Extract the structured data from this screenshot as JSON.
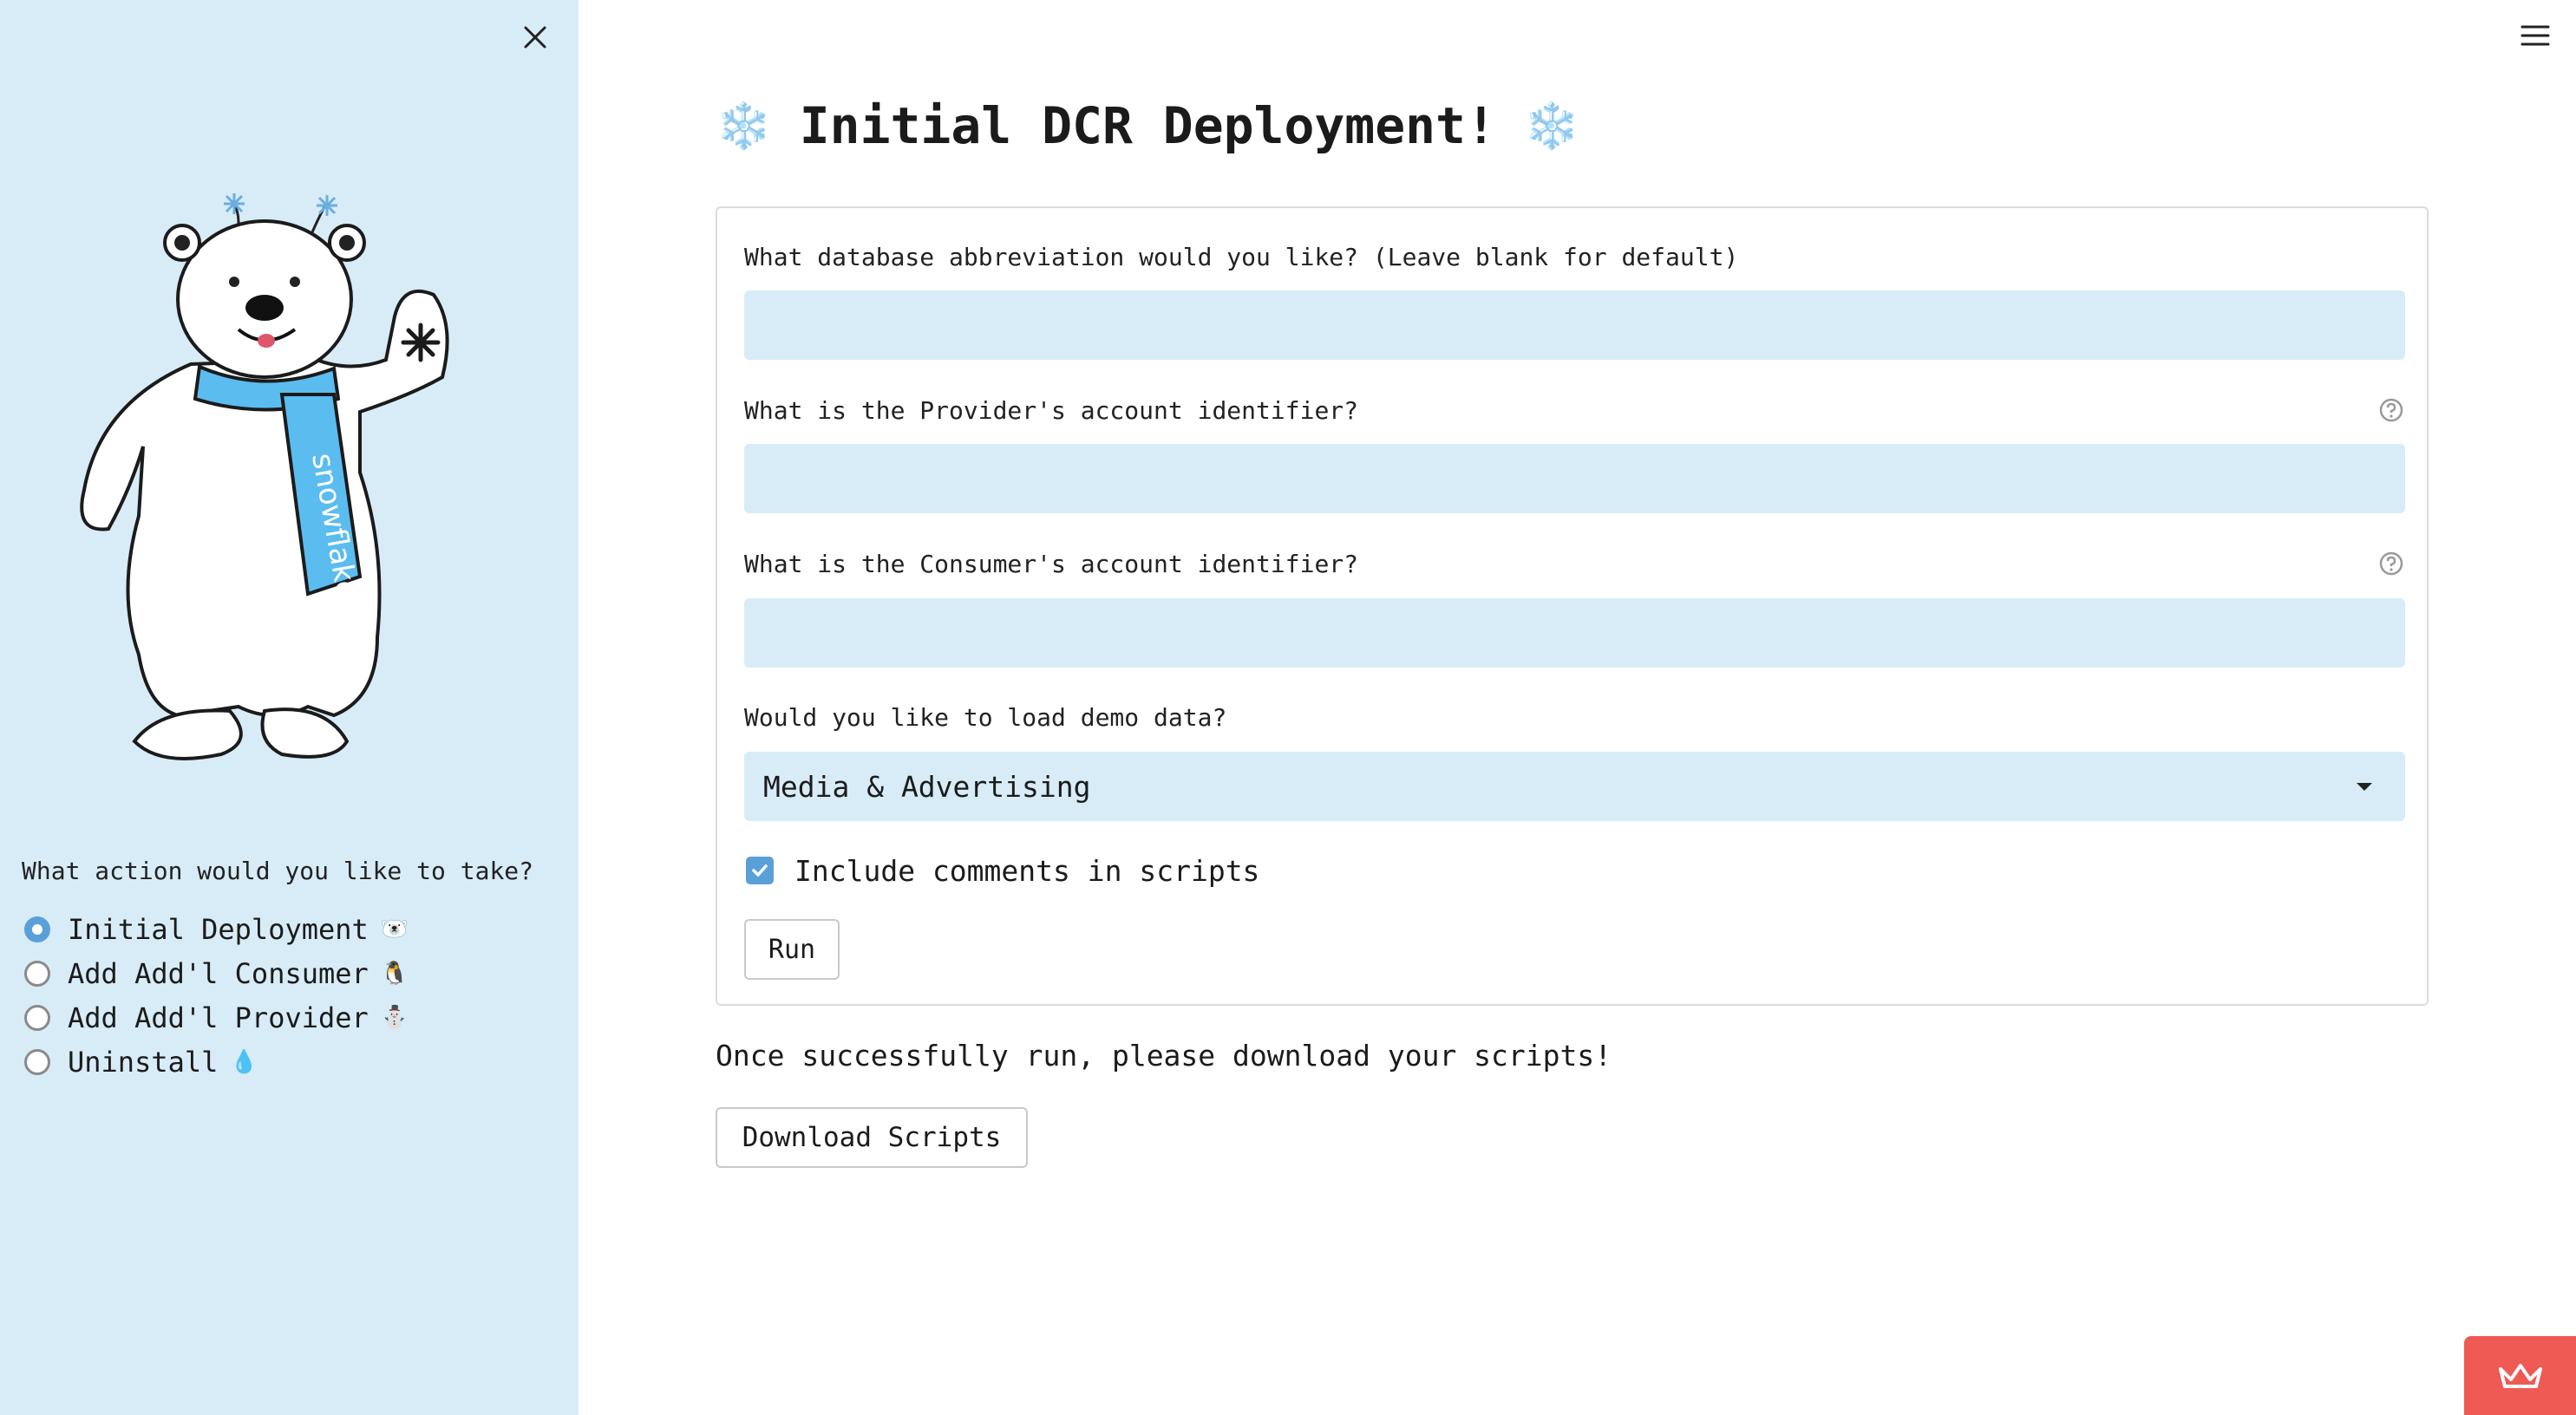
{
  "sidebar": {
    "close_icon": "close-icon",
    "mascot": "polar-bear-mascot",
    "mascot_scarf_text": "snowflake",
    "question": "What action would you like to take?",
    "options": [
      {
        "label": "Initial Deployment",
        "emoji": "🐻‍❄️",
        "selected": true
      },
      {
        "label": "Add Add'l Consumer",
        "emoji": "🐧",
        "selected": false
      },
      {
        "label": "Add Add'l Provider",
        "emoji": "⛄",
        "selected": false
      },
      {
        "label": "Uninstall",
        "emoji": "💧",
        "selected": false
      }
    ]
  },
  "header": {
    "menu_icon": "hamburger-menu-icon",
    "title": "Initial DCR Deployment!",
    "title_icon": "❄️"
  },
  "form": {
    "db_abbrev": {
      "label": "What database abbreviation would you like? (Leave blank for default)",
      "value": ""
    },
    "provider_id": {
      "label": "What is the Provider's account identifier?",
      "value": ""
    },
    "consumer_id": {
      "label": "What is the Consumer's account identifier?",
      "value": ""
    },
    "demo_data": {
      "label": "Would you like to load demo data?",
      "selected": "Media & Advertising"
    },
    "include_comments": {
      "label": "Include comments in scripts",
      "checked": true
    },
    "run_label": "Run"
  },
  "after": {
    "note": "Once successfully run, please download your scripts!",
    "download_label": "Download Scripts"
  },
  "colors": {
    "sidebar_bg": "#d8ecf7",
    "input_bg": "#d8ecf7",
    "accent": "#5aa0d8",
    "badge": "#ef5a55"
  }
}
